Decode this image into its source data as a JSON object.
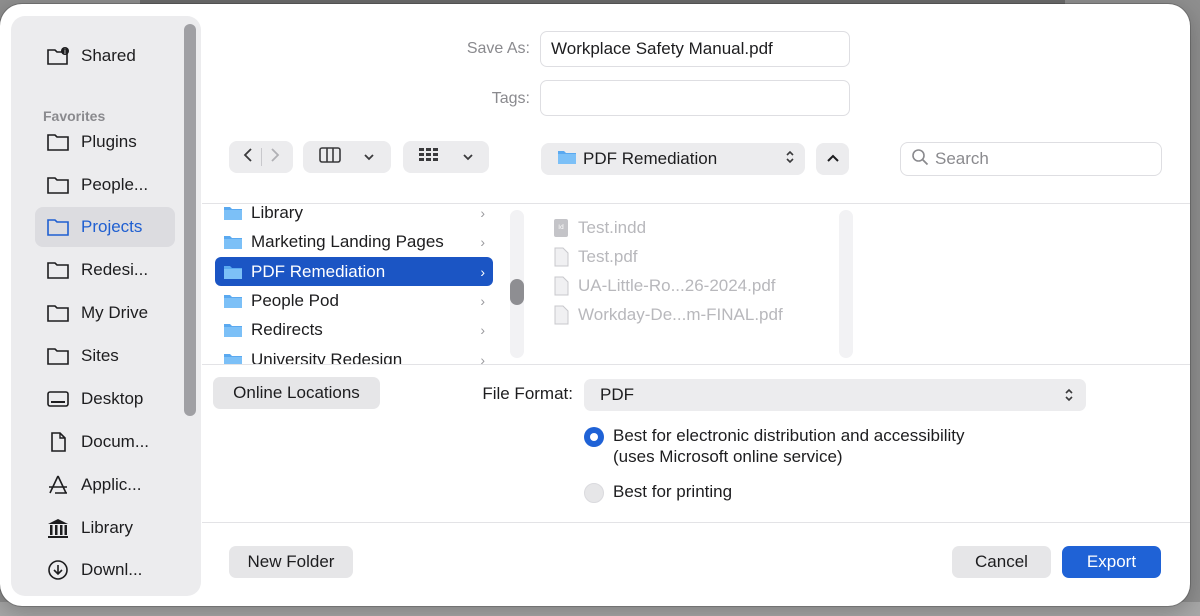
{
  "dialog": {
    "save_as_label": "Save As:",
    "save_as_value": "Workplace Safety Manual.pdf",
    "tags_label": "Tags:",
    "tags_value": ""
  },
  "sidebar": {
    "shared_label": "Shared",
    "favorites_heading": "Favorites",
    "items": [
      {
        "label": "Plugins",
        "icon": "folder-icon"
      },
      {
        "label": "People...",
        "icon": "folder-icon"
      },
      {
        "label": "Projects",
        "icon": "folder-icon",
        "selected": true
      },
      {
        "label": "Redesi...",
        "icon": "folder-icon"
      },
      {
        "label": "My Drive",
        "icon": "folder-icon"
      },
      {
        "label": "Sites",
        "icon": "folder-icon"
      },
      {
        "label": "Desktop",
        "icon": "desktop-icon"
      },
      {
        "label": "Docum...",
        "icon": "document-icon"
      },
      {
        "label": "Applic...",
        "icon": "applications-icon"
      },
      {
        "label": "Library",
        "icon": "library-icon"
      },
      {
        "label": "Downl...",
        "icon": "download-icon"
      }
    ]
  },
  "toolbar": {
    "location": "PDF Remediation",
    "search_placeholder": "Search"
  },
  "browser": {
    "folders": [
      {
        "label": "Library"
      },
      {
        "label": "Marketing Landing Pages"
      },
      {
        "label": "PDF Remediation",
        "selected": true
      },
      {
        "label": "People Pod"
      },
      {
        "label": "Redirects"
      },
      {
        "label": "University Redesign"
      }
    ],
    "files": [
      {
        "label": "Test.indd"
      },
      {
        "label": "Test.pdf"
      },
      {
        "label": "UA-Little-Ro...26-2024.pdf"
      },
      {
        "label": "Workday-De...m-FINAL.pdf"
      }
    ]
  },
  "options": {
    "online_locations": "Online Locations",
    "file_format_label": "File Format:",
    "file_format_value": "PDF",
    "radio_1_line_1": "Best for electronic distribution and accessibility",
    "radio_1_line_2": "(uses Microsoft online service)",
    "radio_2": "Best for printing",
    "selected_option": "Best for electronic distribution and accessibility"
  },
  "footer": {
    "new_folder": "New Folder",
    "cancel": "Cancel",
    "export": "Export"
  },
  "colors": {
    "accent": "#1f62d6",
    "selection": "#1b55c4",
    "sidebar_bg": "#ececee"
  }
}
